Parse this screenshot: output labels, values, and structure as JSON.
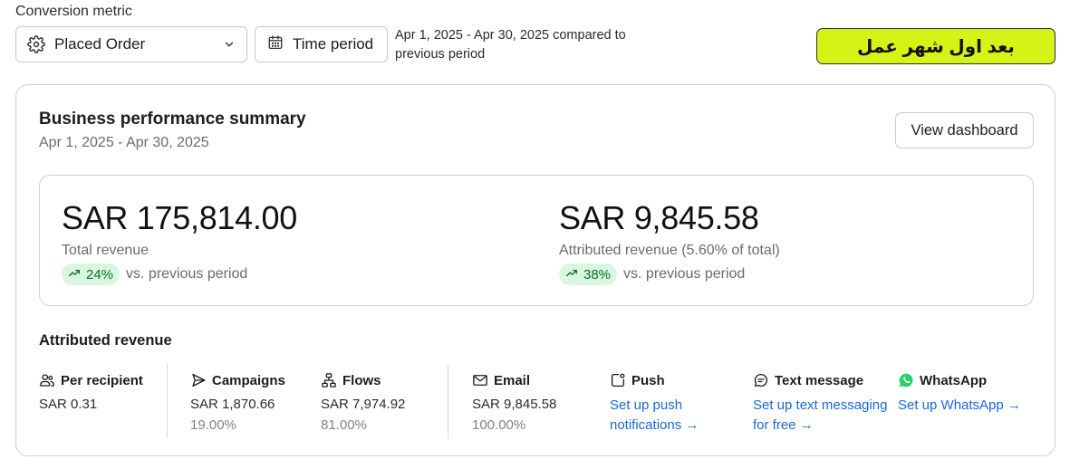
{
  "header": {
    "conversion_label": "Conversion metric",
    "metric_select": {
      "value": "Placed Order",
      "icon": "gear-icon"
    },
    "time_button": {
      "label": "Time period",
      "icon": "calendar-icon"
    },
    "period_text": "Apr 1, 2025 - Apr 30, 2025 compared to previous period",
    "badge": {
      "text": "بعد اول شهر عمل",
      "color": "#d4f418"
    }
  },
  "card": {
    "title": "Business performance summary",
    "subtitle": "Apr 1, 2025 - Apr 30, 2025",
    "view_dashboard": "View dashboard"
  },
  "metrics": {
    "total": {
      "amount": "SAR 175,814.00",
      "label": "Total revenue",
      "change": "24%",
      "vs": "vs. previous period"
    },
    "attributed": {
      "amount": "SAR 9,845.58",
      "label": "Attributed revenue (5.60% of total)",
      "change": "38%",
      "vs": "vs. previous period"
    },
    "positive_color": "#0d6b2a"
  },
  "attributed_revenue": {
    "title": "Attributed revenue",
    "per_recipient": {
      "label": "Per recipient",
      "value": "SAR 0.31",
      "icon": "people-icon"
    },
    "campaigns": {
      "label": "Campaigns",
      "value": "SAR 1,870.66",
      "pct": "19.00%",
      "icon": "send-icon"
    },
    "flows": {
      "label": "Flows",
      "value": "SAR 7,974.92",
      "pct": "81.00%",
      "icon": "flow-icon"
    },
    "email": {
      "label": "Email",
      "value": "SAR 9,845.58",
      "pct": "100.00%",
      "icon": "mail-icon"
    },
    "push": {
      "label": "Push",
      "link": "Set up push notifications →",
      "icon": "push-icon"
    },
    "text": {
      "label": "Text message",
      "link": "Set up text messaging for free →",
      "icon": "chat-icon"
    },
    "whatsapp": {
      "label": "WhatsApp",
      "link": "Set up WhatsApp →",
      "icon": "whatsapp-icon"
    },
    "link_color": "#1769d6"
  }
}
